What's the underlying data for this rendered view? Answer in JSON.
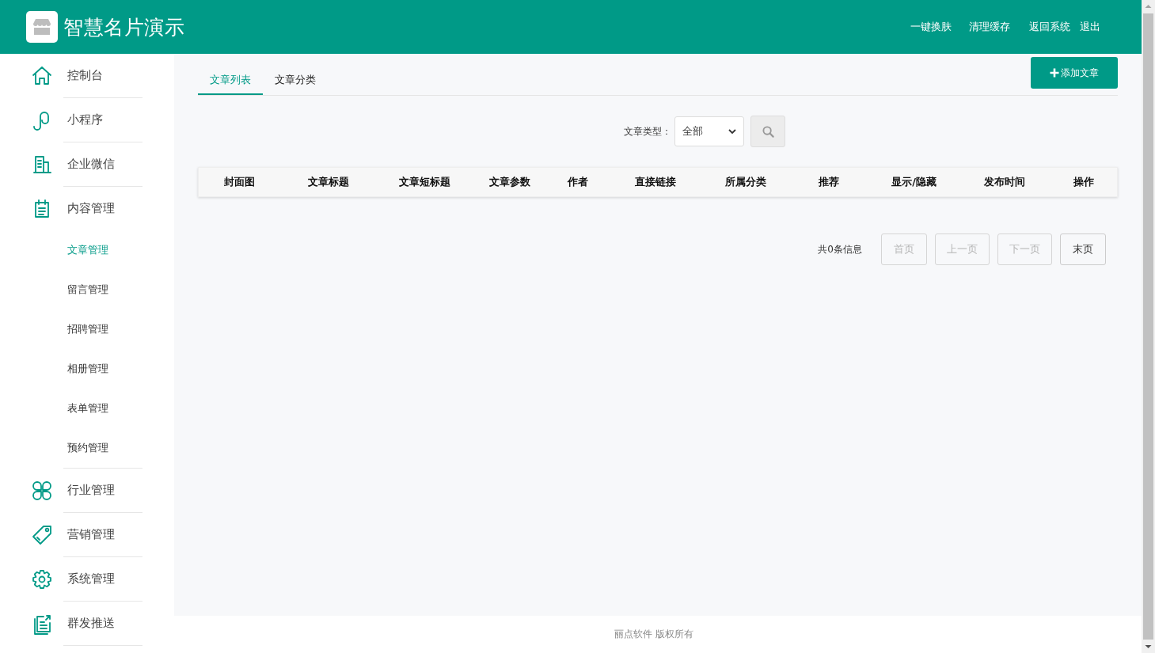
{
  "header": {
    "title": "智慧名片演示",
    "links": [
      "一键换肤",
      "清理缓存",
      "返回系统",
      "退出"
    ]
  },
  "sidebar": {
    "items": [
      {
        "label": "控制台"
      },
      {
        "label": "小程序"
      },
      {
        "label": "企业微信"
      },
      {
        "label": "内容管理",
        "children": [
          {
            "label": "文章管理",
            "selected": true
          },
          {
            "label": "留言管理",
            "selected": false
          },
          {
            "label": "招聘管理",
            "selected": false
          },
          {
            "label": "相册管理",
            "selected": false
          },
          {
            "label": "表单管理",
            "selected": false
          },
          {
            "label": "预约管理",
            "selected": false
          }
        ]
      },
      {
        "label": "行业管理"
      },
      {
        "label": "营销管理"
      },
      {
        "label": "系统管理"
      },
      {
        "label": "群发推送"
      }
    ]
  },
  "tabs": [
    {
      "label": "文章列表",
      "selected": true
    },
    {
      "label": "文章分类",
      "selected": false
    }
  ],
  "add_button": "添加文章",
  "filter": {
    "label": "文章类型：",
    "value": "全部"
  },
  "table": {
    "columns": [
      "封面图",
      "文章标题",
      "文章短标题",
      "文章参数",
      "作者",
      "直接链接",
      "所属分类",
      "推荐",
      "显示/隐藏",
      "发布时间",
      "操作"
    ]
  },
  "pagination": {
    "info": "共0条信息",
    "buttons": [
      {
        "label": "首页",
        "disabled": true
      },
      {
        "label": "上一页",
        "disabled": true
      },
      {
        "label": "下一页",
        "disabled": true
      },
      {
        "label": "末页",
        "disabled": false
      }
    ]
  },
  "footer": "丽点软件 版权所有"
}
